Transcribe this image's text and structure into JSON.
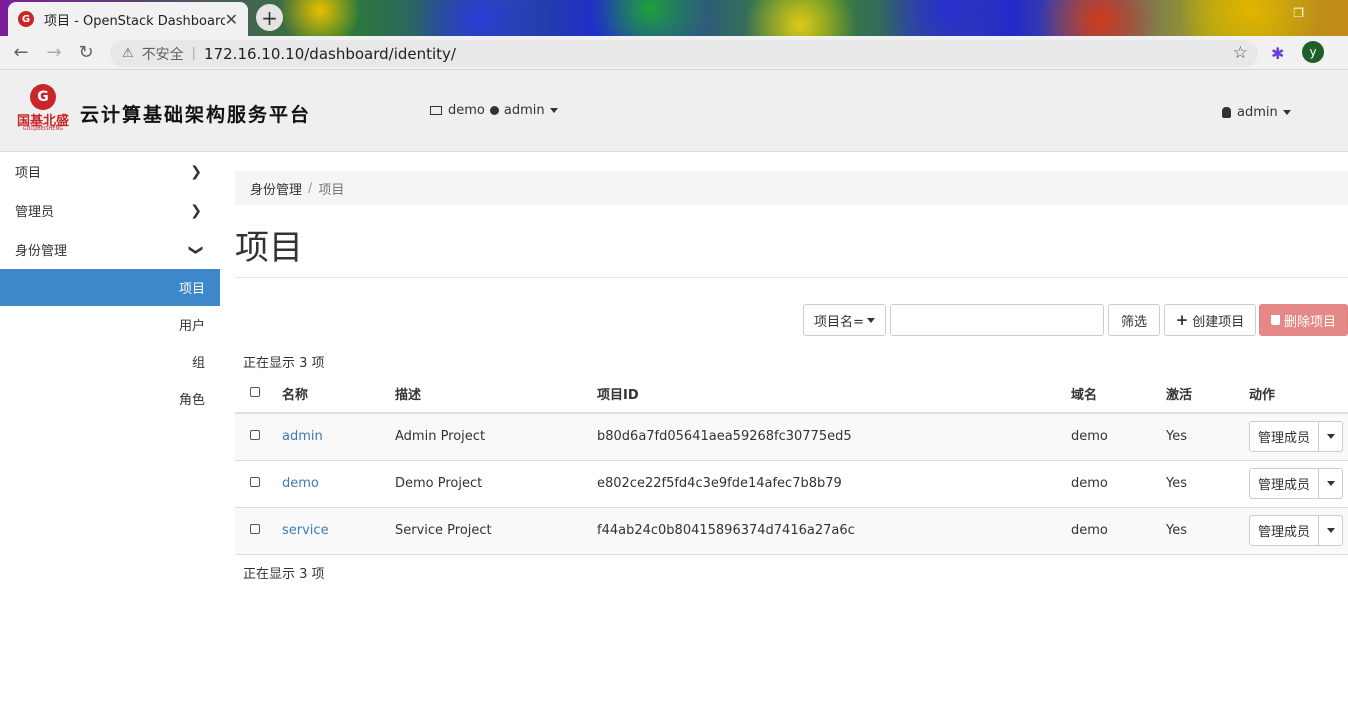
{
  "browser": {
    "tab_title": "项目 - OpenStack Dashboard",
    "tab_favicon": "G",
    "insecure_label": "不安全",
    "url": "172.16.10.10/dashboard/identity/",
    "profile_initial": "y"
  },
  "header": {
    "logo_text": "国基北盛",
    "logo_subtext": "GUOJIBEISHENG",
    "logo_badge": "G",
    "brand_title": "云计算基础架构服务平台",
    "project_context": "demo",
    "role_context": "admin",
    "user_menu": "admin"
  },
  "sidebar": {
    "items": [
      {
        "label": "项目"
      },
      {
        "label": "管理员"
      },
      {
        "label": "身份管理"
      }
    ],
    "subitems": [
      {
        "label": "项目",
        "active": true
      },
      {
        "label": "用户"
      },
      {
        "label": "组"
      },
      {
        "label": "角色"
      }
    ]
  },
  "breadcrumb": {
    "parent": "身份管理",
    "current": "项目"
  },
  "page": {
    "title": "项目"
  },
  "toolbar": {
    "filter_select": "项目名=",
    "filter_value": "",
    "filter_button": "筛选",
    "create_button": "创建项目",
    "delete_button": "删除项目"
  },
  "table": {
    "count_top": "正在显示 3 项",
    "count_bottom": "正在显示 3 项",
    "columns": [
      "名称",
      "描述",
      "项目ID",
      "域名",
      "激活",
      "动作"
    ],
    "rows": [
      {
        "name": "admin",
        "description": "Admin Project",
        "id": "b80d6a7fd05641aea59268fc30775ed5",
        "domain": "demo",
        "enabled": "Yes",
        "action": "管理成员"
      },
      {
        "name": "demo",
        "description": "Demo Project",
        "id": "e802ce22f5fd4c3e9fde14afec7b8b79",
        "domain": "demo",
        "enabled": "Yes",
        "action": "管理成员"
      },
      {
        "name": "service",
        "description": "Service Project",
        "id": "f44ab24c0b80415896374d7416a27a6c",
        "domain": "demo",
        "enabled": "Yes",
        "action": "管理成员"
      }
    ]
  },
  "colors": {
    "accent": "#3e87c9",
    "danger": "#e48987",
    "link": "#3e7bb6",
    "brand_red": "#c9262a"
  },
  "icons": [
    "back-icon",
    "forward-icon",
    "reload-icon",
    "warning-icon",
    "star-icon",
    "extension-icon",
    "chevron-right-icon",
    "chevron-down-icon",
    "plus-icon",
    "trash-icon",
    "caret-down-icon",
    "user-icon",
    "server-icon"
  ]
}
